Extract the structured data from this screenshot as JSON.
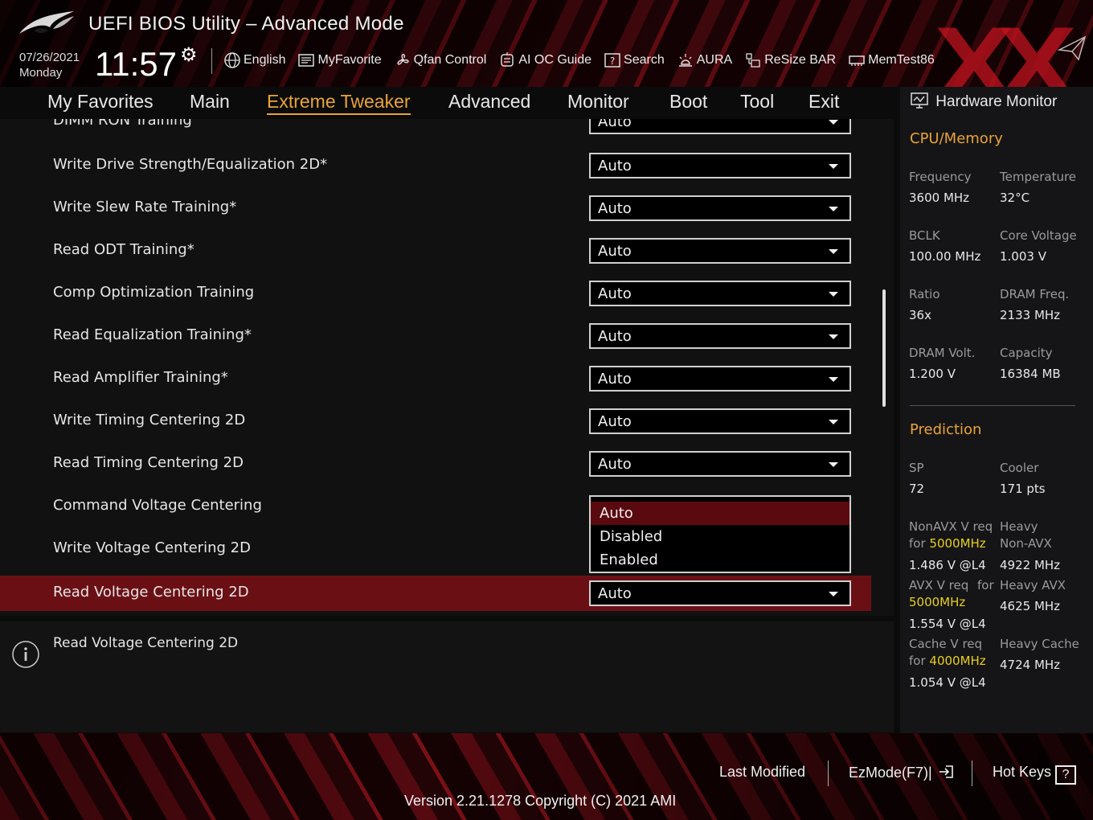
{
  "header": {
    "title": "UEFI BIOS Utility – Advanced Mode",
    "date": "07/26/2021",
    "day": "Monday",
    "time": "11:57",
    "toolbar": [
      {
        "label": "English",
        "icon": "globe-icon"
      },
      {
        "label": "MyFavorite",
        "icon": "favorite-list-icon"
      },
      {
        "label": "Qfan Control",
        "icon": "fan-icon"
      },
      {
        "label": "AI OC Guide",
        "icon": "ai-oc-guide-icon"
      },
      {
        "label": "Search",
        "icon": "search-help-icon"
      },
      {
        "label": "AURA",
        "icon": "aura-light-icon"
      },
      {
        "label": "ReSize BAR",
        "icon": "resize-bar-icon"
      },
      {
        "label": "MemTest86",
        "icon": "memtest-icon"
      }
    ],
    "watermark": "XX"
  },
  "nav": {
    "tabs": [
      "My Favorites",
      "Main",
      "Extreme Tweaker",
      "Advanced",
      "Monitor",
      "Boot",
      "Tool",
      "Exit"
    ],
    "active": "Extreme Tweaker"
  },
  "settings": {
    "rows": [
      {
        "label": "DIMM RON Training",
        "value": "Auto"
      },
      {
        "label": "Write Drive Strength/Equalization 2D*",
        "value": "Auto"
      },
      {
        "label": "Write Slew Rate Training*",
        "value": "Auto"
      },
      {
        "label": "Read ODT Training*",
        "value": "Auto"
      },
      {
        "label": "Comp Optimization Training",
        "value": "Auto"
      },
      {
        "label": "Read Equalization Training*",
        "value": "Auto"
      },
      {
        "label": "Read Amplifier Training*",
        "value": "Auto"
      },
      {
        "label": "Write Timing Centering 2D",
        "value": "Auto"
      },
      {
        "label": "Read Timing Centering 2D",
        "value": "Auto"
      },
      {
        "label": "Command Voltage Centering",
        "value": "Auto"
      },
      {
        "label": "Write Voltage Centering 2D",
        "value": "Auto"
      },
      {
        "label": "Read Voltage Centering 2D",
        "value": "Auto"
      }
    ],
    "dropdown_options": [
      "Auto",
      "Disabled",
      "Enabled"
    ],
    "dropdown_selected": "Auto"
  },
  "help": {
    "text": "Read Voltage Centering 2D"
  },
  "hw_monitor": {
    "title": "Hardware Monitor",
    "cpu_memory": {
      "heading": "CPU/Memory",
      "frequency_label": "Frequency",
      "frequency": "3600 MHz",
      "temperature_label": "Temperature",
      "temperature": "32°C",
      "bclk_label": "BCLK",
      "bclk": "100.00 MHz",
      "core_voltage_label": "Core Voltage",
      "core_voltage": "1.003 V",
      "ratio_label": "Ratio",
      "ratio": "36x",
      "dram_freq_label": "DRAM Freq.",
      "dram_freq": "2133 MHz",
      "dram_volt_label": "DRAM Volt.",
      "dram_volt": "1.200 V",
      "capacity_label": "Capacity",
      "capacity": "16384 MB"
    },
    "prediction": {
      "heading": "Prediction",
      "sp_label": "SP",
      "sp": "72",
      "cooler_label": "Cooler",
      "cooler": "171 pts",
      "nonavx_req_label": "NonAVX V req",
      "nonavx_for": "for",
      "nonavx_freq": "5000MHz",
      "nonavx_v": "1.486 V @L4",
      "heavy_nonavx_label_1": "Heavy",
      "heavy_nonavx_label_2": "Non-AVX",
      "heavy_nonavx": "4922 MHz",
      "avx_req_label": "AVX V req",
      "avx_for": "for",
      "avx_freq": "5000MHz",
      "avx_v": "1.554 V @L4",
      "heavy_avx_label": "Heavy AVX",
      "heavy_avx": "4625 MHz",
      "cache_req_label": "Cache V req",
      "cache_for": "for",
      "cache_freq": "4000MHz",
      "cache_v": "1.054 V @L4",
      "heavy_cache_label": "Heavy Cache",
      "heavy_cache": "4724 MHz"
    }
  },
  "footer": {
    "last_modified": "Last Modified",
    "ezmode": "EzMode(F7)|",
    "hot_keys": "Hot Keys",
    "hot_keys_glyph": "?",
    "version": "Version 2.21.1278 Copyright (C) 2021 AMI"
  },
  "colors": {
    "accent": "#e8a33a",
    "selected_row": "#6a1015",
    "highlight_freq": "#e8d020"
  }
}
